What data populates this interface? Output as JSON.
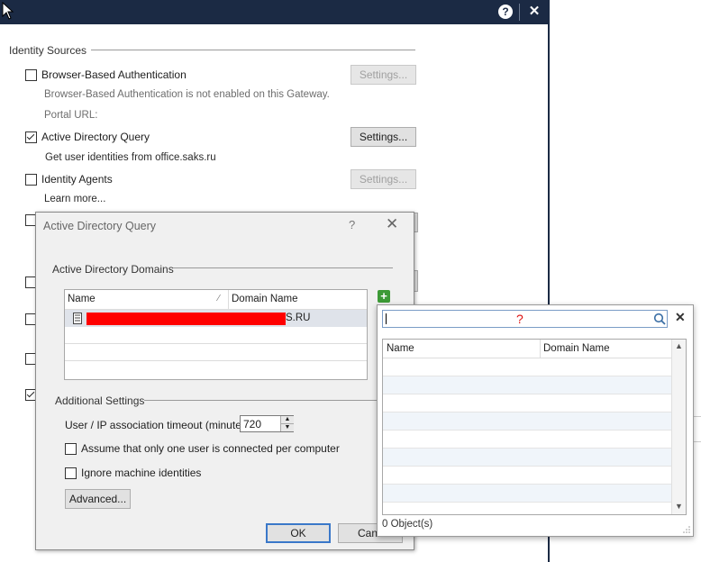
{
  "main": {
    "help_icon": "?",
    "close_icon": "✕",
    "identity_sources_title": "Identity Sources",
    "items": [
      {
        "label": "Browser-Based Authentication",
        "checked": false,
        "button": "Settings...",
        "button_enabled": false,
        "notes": [
          "Browser-Based Authentication is not enabled on this Gateway.",
          "Portal URL:"
        ]
      },
      {
        "label": "Active Directory Query",
        "checked": true,
        "button": "Settings...",
        "button_enabled": true,
        "notes": [
          "Get user identities from office.saks.ru"
        ]
      },
      {
        "label": "Identity Agents",
        "checked": false,
        "button": "Settings...",
        "button_enabled": false,
        "notes": [
          "Learn more..."
        ]
      }
    ]
  },
  "dialog": {
    "title": "Active Directory Query",
    "help": "?",
    "close": "✕",
    "domains_section": "Active Directory Domains",
    "columns": [
      "Name",
      "Domain Name"
    ],
    "rows": [
      {
        "name": "",
        "domain": "S.RU"
      }
    ],
    "add_icon": "+",
    "additional_section": "Additional Settings",
    "timeout_label": "User / IP association timeout (minutes):",
    "timeout_value": "720",
    "option_one_user": "Assume that only one user is connected per computer",
    "option_ignore_machines": "Ignore machine identities",
    "advanced_button": "Advanced...",
    "ok_button": "OK",
    "cancel_button": "Canc"
  },
  "popup": {
    "search_value": "",
    "search_marker": "?",
    "columns": [
      "Name",
      "Domain Name"
    ],
    "status": "0 Object(s)",
    "close": "✕"
  },
  "colors": {
    "titlebar": "#1b2a44",
    "redaction": "#ff0000",
    "add_green": "#3c9a36"
  }
}
